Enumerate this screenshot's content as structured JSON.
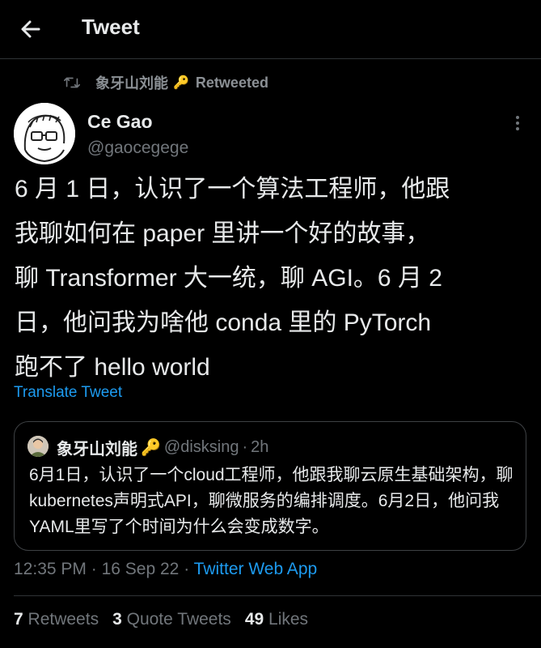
{
  "header": {
    "title": "Tweet"
  },
  "retweet": {
    "name": "象牙山刘能",
    "key_emoji": "🔑",
    "label": "Retweeted"
  },
  "author": {
    "name": "Ce Gao",
    "handle": "@gaocegege"
  },
  "tweet": {
    "text": "6 月 1 日，认识了一个算法工程师，他跟\n我聊如何在 paper 里讲一个好的故事，\n聊 Transformer 大一统，聊 AGI。6 月 2\n日，他问我为啥他 conda 里的 PyTorch\n跑不了 hello world",
    "translate_label": "Translate Tweet"
  },
  "quote": {
    "name": "象牙山刘能",
    "key_emoji": "🔑",
    "handle": "@disksing",
    "separator": "·",
    "time": "2h",
    "text": "6月1日，认识了一个cloud工程师，他跟我聊云原生基础架构，聊kubernetes声明式API，聊微服务的编排调度。6月2日，他问我YAML里写了个时间为什么会变成数字。"
  },
  "meta": {
    "time": "12:35 PM",
    "sep1": "·",
    "date": "16 Sep 22",
    "sep2": "·",
    "app": "Twitter Web App"
  },
  "stats": {
    "retweets_count": "7",
    "retweets_label": "Retweets",
    "quotes_count": "3",
    "quotes_label": "Quote Tweets",
    "likes_count": "49",
    "likes_label": "Likes"
  },
  "colors": {
    "background": "#000000",
    "text": "#e7e9ea",
    "muted": "#71767b",
    "link": "#1d9bf0"
  }
}
